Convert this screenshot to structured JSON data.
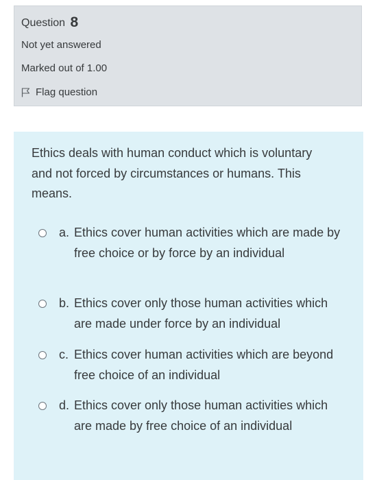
{
  "question_info": {
    "label": "Question",
    "number": "8",
    "state": "Not yet answered",
    "grade": "Marked out of 1.00",
    "flag_label": "Flag question"
  },
  "question": {
    "text": "Ethics deals with human conduct which is voluntary and not forced by circumstances or humans. This means.",
    "answers": [
      {
        "letter": "a.",
        "text": "Ethics cover human activities which are made by free choice or by force by an individual"
      },
      {
        "letter": "b.",
        "text": "Ethics cover only those human activities which are made under force by an individual"
      },
      {
        "letter": "c.",
        "text": "Ethics cover human activities which are beyond free choice of an individual"
      },
      {
        "letter": "d.",
        "text": "Ethics cover only those human activities which are made by free choice of an individual"
      }
    ]
  },
  "colors": {
    "info_background": "#dee2e6",
    "content_background": "#def2f8",
    "text": "#373a3c"
  },
  "icons": {
    "flag": "flag-icon",
    "radio": "radio-unchecked-icon"
  }
}
